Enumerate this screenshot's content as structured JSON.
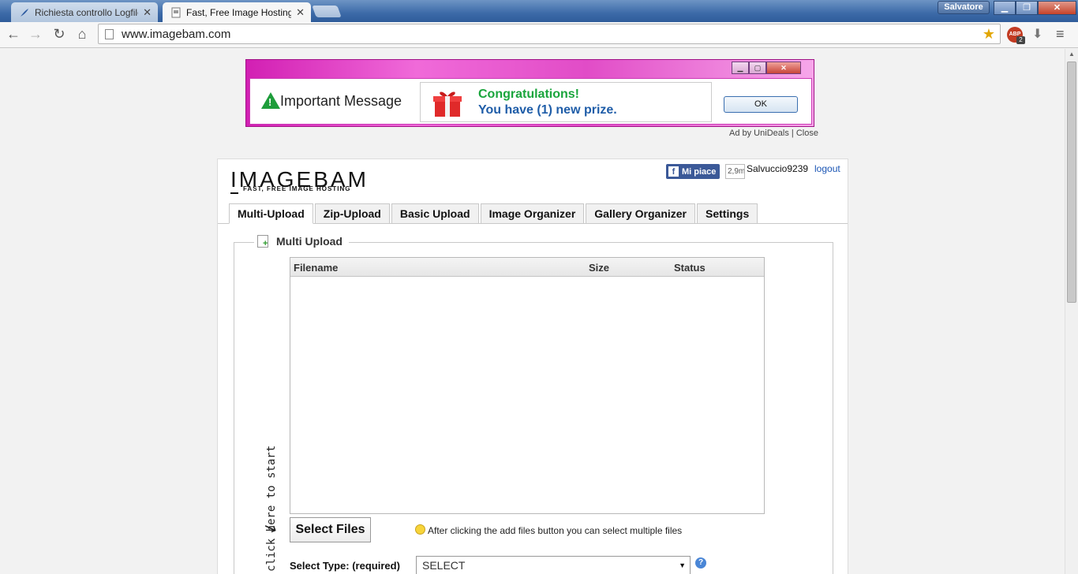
{
  "browser": {
    "tabs": [
      {
        "title": "Richiesta controllo Logfile",
        "active": false,
        "icon": "feather-icon"
      },
      {
        "title": "Fast, Free Image Hosting -",
        "active": true,
        "icon": "page-icon"
      }
    ],
    "profile_name": "Salvatore",
    "url": "www.imagebam.com",
    "extension_badge": "ABP",
    "extension_count": "2"
  },
  "ad": {
    "heading": "Important Message",
    "line1": "Congratulations!",
    "line2": "You have (1) new prize.",
    "ok_label": "OK",
    "attribution": "Ad by UniDeals",
    "separator": "|",
    "close_label": "Close",
    "colors": {
      "frame": "#d21fb3",
      "green": "#1aa53c",
      "blue": "#1f5da8"
    }
  },
  "site": {
    "logo": "IMAGEBAM",
    "tagline": "FAST, FREE IMAGE HOSTING",
    "fb_like_label": "Mi piace",
    "fb_count": "2,9m",
    "username": "Salvuccio9239",
    "logout_label": "logout",
    "tabs": [
      {
        "label": "Multi-Upload",
        "active": true
      },
      {
        "label": "Zip-Upload",
        "active": false
      },
      {
        "label": "Basic Upload",
        "active": false
      },
      {
        "label": "Image Organizer",
        "active": false
      },
      {
        "label": "Gallery Organizer",
        "active": false
      },
      {
        "label": "Settings",
        "active": false
      }
    ],
    "upload": {
      "legend": "Multi Upload",
      "columns": {
        "filename": "Filename",
        "size": "Size",
        "status": "Status"
      },
      "click_hint": "click here to start",
      "select_files_label": "Select Files",
      "hint": "After clicking the add files button you can select multiple files",
      "select_type_label": "Select Type: (required)",
      "select_type_value": "SELECT"
    }
  }
}
